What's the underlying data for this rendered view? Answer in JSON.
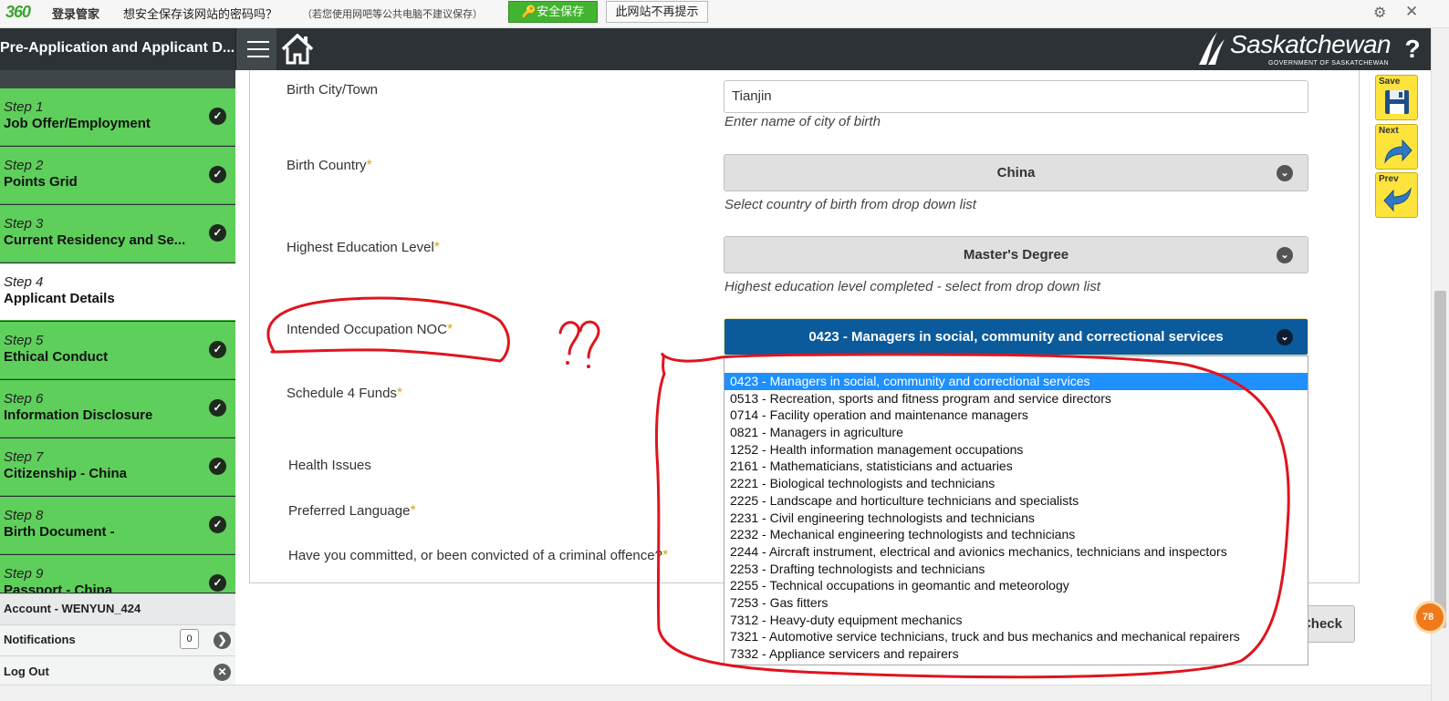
{
  "browser_bar": {
    "logo": "360",
    "brand": "登录管家",
    "message": "想安全保存该网站的密码吗？",
    "note": "（若您使用网吧等公共电脑不建议保存）",
    "save_button": "安全保存",
    "no_more_button": "此网站不再提示"
  },
  "header": {
    "title": "Pre-Application and Applicant D...",
    "brand_name": "Saskatchewan",
    "brand_sub": "GOVERNMENT OF SASKATCHEWAN"
  },
  "sidebar": {
    "steps": [
      {
        "num": "Step 1",
        "name": "Job Offer/Employment",
        "done": true
      },
      {
        "num": "Step 2",
        "name": "Points Grid",
        "done": true
      },
      {
        "num": "Step 3",
        "name": "Current Residency and Se...",
        "done": true
      },
      {
        "num": "Step 4",
        "name": "Applicant Details",
        "done": false
      },
      {
        "num": "Step 5",
        "name": "Ethical Conduct",
        "done": true
      },
      {
        "num": "Step 6",
        "name": "Information Disclosure",
        "done": true
      },
      {
        "num": "Step 7",
        "name": "Citizenship - China",
        "done": true
      },
      {
        "num": "Step 8",
        "name": "Birth Document -",
        "done": true
      },
      {
        "num": "Step 9",
        "name": "Passport - China",
        "done": true
      }
    ],
    "account": "Account - WENYUN_424",
    "notifications_label": "Notifications",
    "notifications_count": "0",
    "logout_label": "Log Out"
  },
  "form": {
    "birth_city_label": "Birth City/Town",
    "birth_city_value": "Tianjin",
    "birth_city_hint": "Enter name of city of birth",
    "birth_country_label": "Birth Country",
    "birth_country_value": "China",
    "birth_country_hint": "Select country of birth from drop down list",
    "education_label": "Highest Education Level",
    "education_value": "Master's Degree",
    "education_hint": "Highest education level completed - select from drop down list",
    "noc_label": "Intended Occupation NOC",
    "noc_value": "0423 - Managers in social, community and correctional services",
    "funds_label": "Schedule 4 Funds",
    "health_label": "Health Issues",
    "language_label": "Preferred Language",
    "criminal_label": "Have you committed, or been convicted of a criminal offence?",
    "required_mark": "*",
    "complete_button": "Check Completeness",
    "noc_options": [
      "0423 - Managers in social, community and correctional services",
      "0513 - Recreation, sports and fitness program and service directors",
      "0714 - Facility operation and maintenance managers",
      "0821 - Managers in agriculture",
      "1252 - Health information management occupations",
      "2161 - Mathematicians, statisticians and actuaries",
      "2221 - Biological technologists and technicians",
      "2225 - Landscape and horticulture technicians and specialists",
      "2231 - Civil engineering technologists and technicians",
      "2232 - Mechanical engineering technologists and technicians",
      "2244 - Aircraft instrument, electrical and avionics mechanics, technicians and inspectors",
      "2253 - Drafting technologists and technicians",
      "2255 - Technical occupations in geomantic and meteorology",
      "7253 - Gas fitters",
      "7312 - Heavy-duty equipment mechanics",
      "7321 - Automotive service technicians, truck and bus mechanics and mechanical repairers",
      "7332 - Appliance servicers and repairers"
    ]
  },
  "toolbar": {
    "save_label": "Save",
    "next_label": "Next",
    "prev_label": "Prev"
  },
  "float_badge": "78",
  "annotation": {
    "question_marks": "??"
  },
  "colors": {
    "step_complete": "#5ecf5b",
    "header_bg": "#2c3235",
    "select_active": "#0b5a9c",
    "annotation_red": "#e0141e",
    "toolbar_yellow": "#fde33c"
  }
}
